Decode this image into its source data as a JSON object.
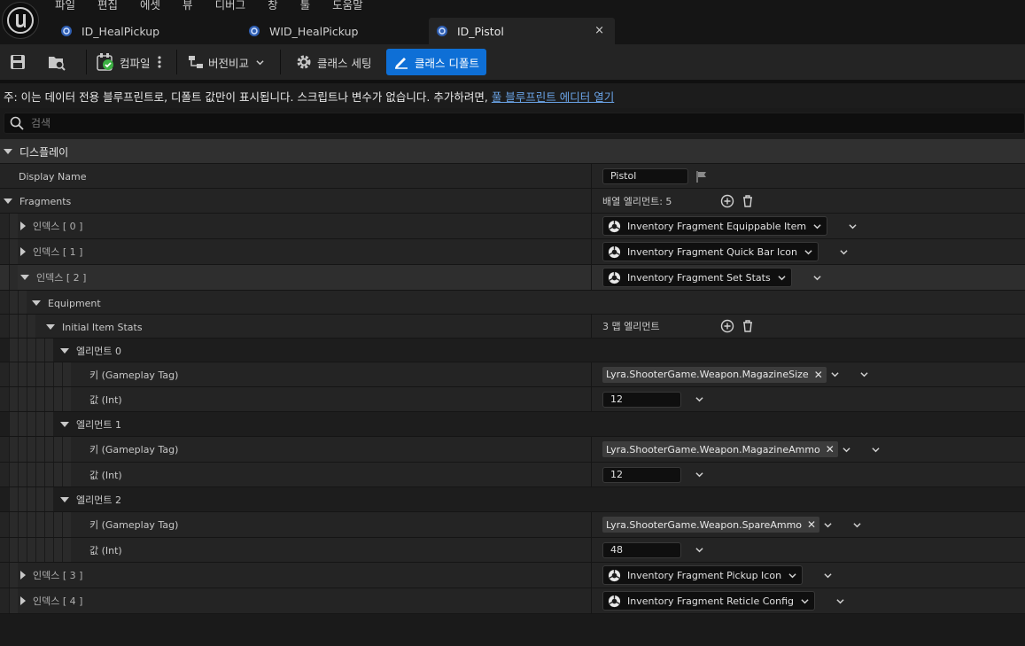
{
  "menu": [
    "파일",
    "편집",
    "에셋",
    "뷰",
    "디버그",
    "창",
    "툴",
    "도움말"
  ],
  "tabs": [
    {
      "label": "ID_HealPickup"
    },
    {
      "label": "WID_HealPickup"
    },
    {
      "label": "ID_Pistol",
      "close": "×"
    }
  ],
  "toolbar": {
    "compile": "컴파일",
    "diff": "버전비교",
    "class_settings": "클래스 세팅",
    "class_defaults": "클래스 디폴트"
  },
  "notice": {
    "text": "주: 이는 데이터 전용 블루프린트로, 디폴트 값만이 표시됩니다. 스크립트나 변수가 없습니다. 추가하려면,",
    "link": "풀 블루프린트 에디터 열기"
  },
  "search": {
    "placeholder": "검색"
  },
  "details": {
    "category": "디스플레이",
    "display_name": {
      "label": "Display Name",
      "value": "Pistol"
    },
    "fragments": {
      "label": "Fragments",
      "count": "배열 엘리먼트: 5"
    },
    "index0": {
      "label": "인덱스 [ 0 ]",
      "value": "Inventory Fragment Equippable Item"
    },
    "index1": {
      "label": "인덱스 [ 1 ]",
      "value": "Inventory Fragment Quick Bar Icon"
    },
    "index2": {
      "label": "인덱스 [ 2 ]",
      "value": "Inventory Fragment Set Stats"
    },
    "equipment": "Equipment",
    "initial_stats": {
      "label": "Initial Item Stats",
      "count": "3 맵 엘리먼트"
    },
    "elements": [
      {
        "label": "엘리먼트 0",
        "key_label": "키 (Gameplay Tag)",
        "key": "Lyra.ShooterGame.Weapon.MagazineSize",
        "val_label": "값 (Int)",
        "value": "12"
      },
      {
        "label": "엘리먼트 1",
        "key_label": "키 (Gameplay Tag)",
        "key": "Lyra.ShooterGame.Weapon.MagazineAmmo",
        "val_label": "값 (Int)",
        "value": "12"
      },
      {
        "label": "엘리먼트 2",
        "key_label": "키 (Gameplay Tag)",
        "key": "Lyra.ShooterGame.Weapon.SpareAmmo",
        "val_label": "값 (Int)",
        "value": "48"
      }
    ],
    "index3": {
      "label": "인덱스 [ 3 ]",
      "value": "Inventory Fragment Pickup Icon"
    },
    "index4": {
      "label": "인덱스 [ 4 ]",
      "value": "Inventory Fragment Reticle Config"
    }
  },
  "colors": {
    "accent": "#0e6fd6",
    "link": "#6aa3e6",
    "compile_ok": "#3cb043"
  }
}
